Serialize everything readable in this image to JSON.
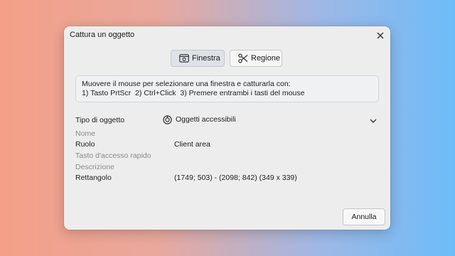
{
  "dialog": {
    "title": "Cattura un oggetto"
  },
  "modes": {
    "window_label": "Finestra",
    "region_label": "Regione"
  },
  "instructions": {
    "line1": "Muovere il mouse per selezionare una finestra e catturarla con:",
    "line2": "1) Tasto PrtScr  2) Ctrl+Click  3) Premere entrambi i tasti del mouse"
  },
  "properties": {
    "object_type_label": "Tipo di oggetto",
    "object_type_value": "Oggetti accessibili",
    "name_label": "Nome",
    "name_value": "",
    "role_label": "Ruolo",
    "role_value": "Client area",
    "access_key_label": "Tasto d'accesso rapido",
    "access_key_value": "",
    "description_label": "Descrizione",
    "description_value": "",
    "rectangle_label": "Rettangolo",
    "rectangle_value": "(1749; 503) - (2098; 842) (349 x 339)"
  },
  "footer": {
    "cancel_label": "Annulla"
  }
}
